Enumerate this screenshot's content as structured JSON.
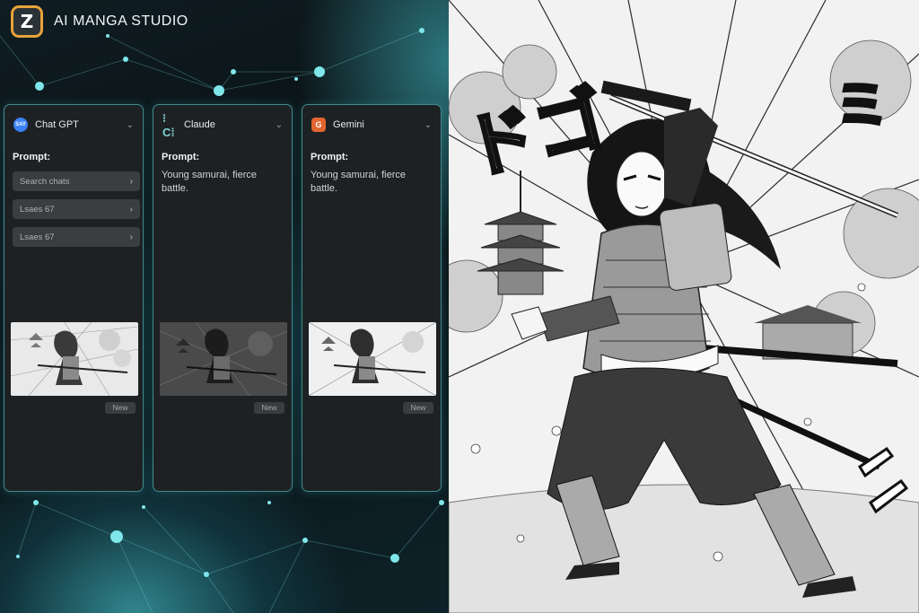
{
  "app": {
    "logo_letter": "Z",
    "title": "AI MANGA STUDIO",
    "accent": "#e8a23a",
    "teal": "#3f8b8e"
  },
  "cards": [
    {
      "model": "Chat GPT",
      "icon": "chatgpt-icon",
      "icon_text": "SAY",
      "prompt_label": "Prompt:",
      "items": [
        "Search chats",
        "Lsaes 67",
        "Lsaes 67"
      ],
      "badge": "New"
    },
    {
      "model": "Claude",
      "icon": "claude-icon",
      "icon_text": "⁝C⁞",
      "prompt_label": "Prompt:",
      "prompt": "Young samurai, fierce battle.",
      "badge": "New"
    },
    {
      "model": "Gemini",
      "icon": "gemini-icon",
      "icon_text": "G",
      "prompt_label": "Prompt:",
      "prompt": "Young samurai, fierce battle.",
      "badge": "New"
    }
  ],
  "artwork": {
    "sfx_left": "ドゴ",
    "sfx_right": "ミ"
  }
}
